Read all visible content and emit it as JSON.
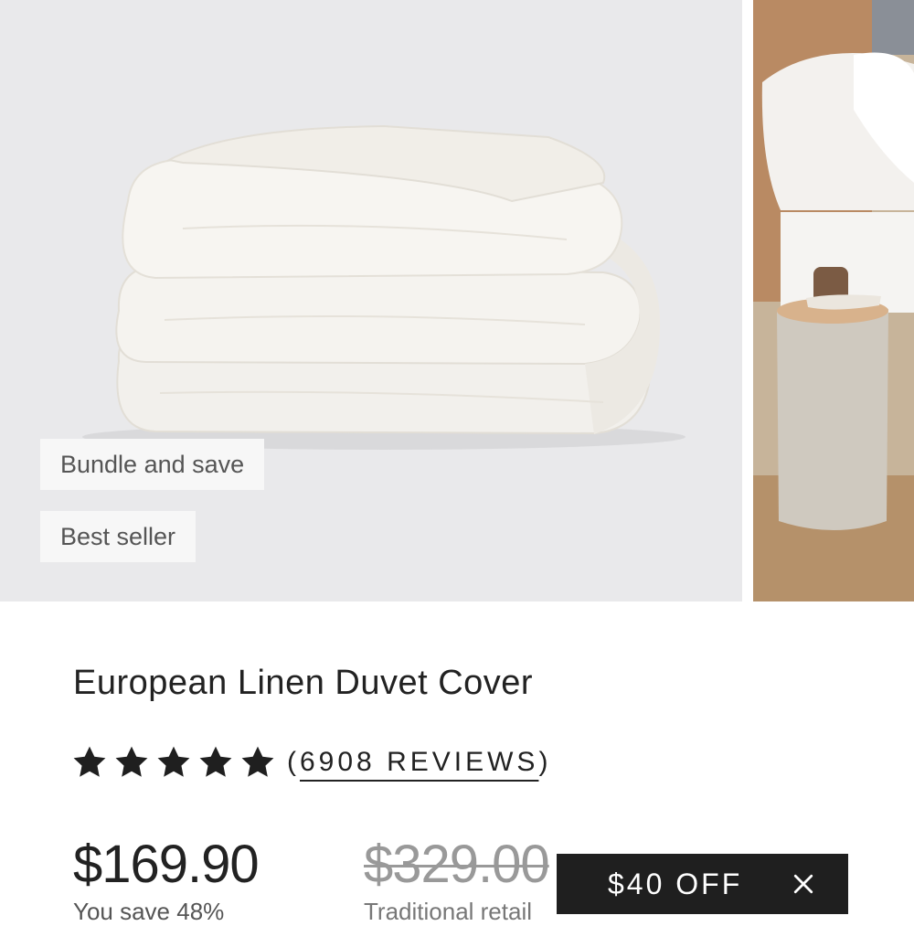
{
  "gallery": {
    "main_image_alt": "",
    "badges": [
      "Bundle and save",
      "Best seller"
    ]
  },
  "product": {
    "title": "European Linen Duvet Cover",
    "rating": {
      "stars": 5,
      "out_of": 5,
      "reviews_open": "(",
      "reviews_label": "6908 REVIEWS",
      "reviews_close": ")"
    },
    "price": "$169.90",
    "savings": "You save 48%",
    "old_price": "$329.00",
    "retail_label": "Traditional retail"
  },
  "promo": {
    "label": "$40 OFF",
    "close_icon": "close-icon"
  },
  "colors": {
    "main_bg": "#e9e9eb",
    "promo_bg": "#1f1f1f",
    "text": "#222222"
  }
}
